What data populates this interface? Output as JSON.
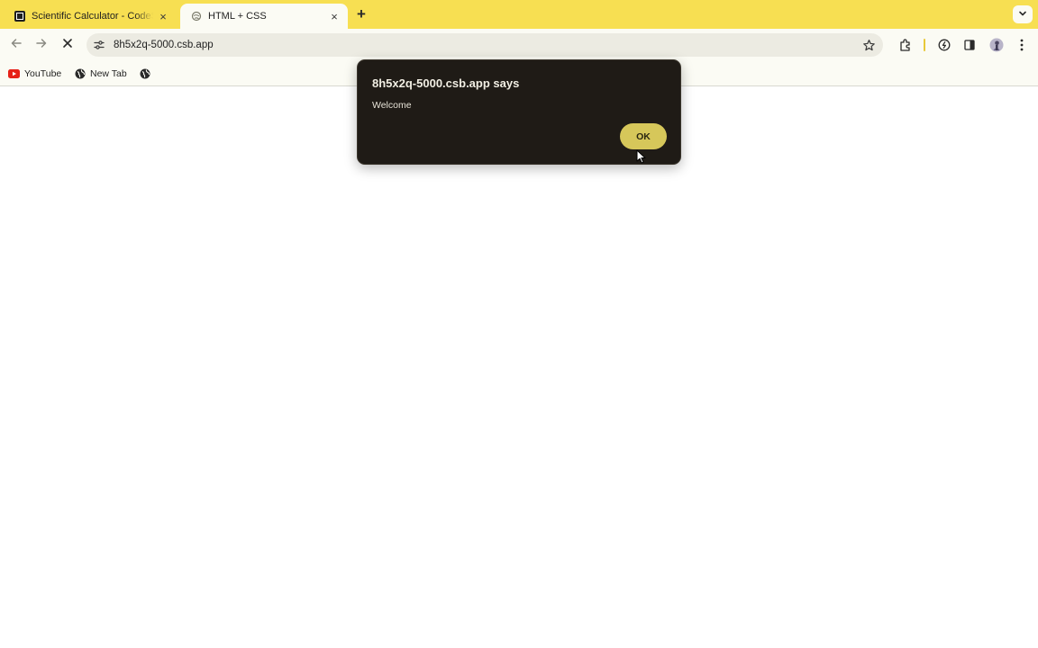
{
  "browser": {
    "tabs": [
      {
        "title": "Scientific Calculator - CodeSandbox",
        "close": "×"
      },
      {
        "title": "HTML + CSS",
        "close": "×"
      }
    ],
    "new_tab_label": "+",
    "address_bar": {
      "url": "8h5x2q-5000.csb.app"
    },
    "bookmarks": [
      {
        "label": "YouTube"
      },
      {
        "label": "New Tab"
      }
    ]
  },
  "dialog": {
    "title": "8h5x2q-5000.csb.app says",
    "message": "Welcome",
    "ok_label": "OK"
  },
  "colors": {
    "tabstrip": "#f7df52",
    "toolbar": "#fbfbf4",
    "dialog_bg": "#1f1b16",
    "ok_button": "#d6c75a",
    "youtube_red": "#e62117"
  },
  "icons": {
    "back": "arrow-left-icon",
    "forward": "arrow-right-icon",
    "stop": "close-icon",
    "site_info": "tune-icon",
    "bookmark_star": "star-icon",
    "extensions": "puzzle-icon",
    "side_panel": "side-panel-icon",
    "menu": "kebab-menu-icon"
  }
}
